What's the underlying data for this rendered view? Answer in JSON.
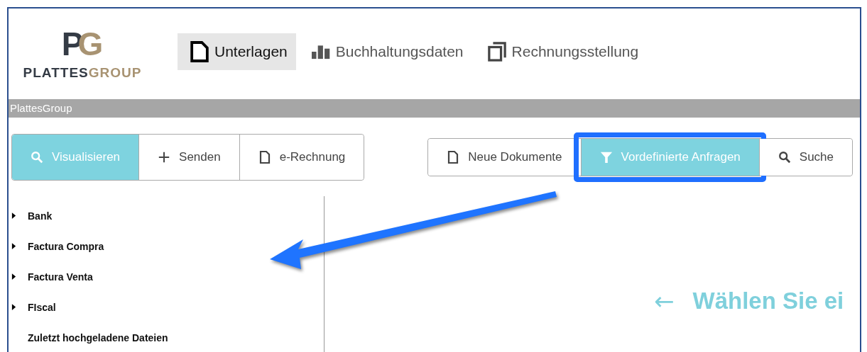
{
  "logo": {
    "mark": [
      "P",
      "G"
    ],
    "word": [
      "PLATTES",
      "GROUP"
    ]
  },
  "nav": [
    {
      "label": "Unterlagen",
      "selected": true
    },
    {
      "label": "Buchhaltungsdaten",
      "selected": false
    },
    {
      "label": "Rechnungsstellung",
      "selected": false
    }
  ],
  "breadcrumb": "PlattesGroup",
  "mode_buttons": [
    {
      "label": "Visualisieren",
      "selected": true
    },
    {
      "label": "Senden",
      "selected": false
    },
    {
      "label": "e-Rechnung",
      "selected": false
    }
  ],
  "view_buttons": [
    {
      "label": "Neue Dokumente",
      "selected": false
    },
    {
      "label": "Vordefinierte Anfragen",
      "selected": true
    },
    {
      "label": "Suche",
      "selected": false
    }
  ],
  "tree": [
    {
      "label": "Bank",
      "kind": "folder",
      "expanded": false
    },
    {
      "label": "Factura Compra",
      "kind": "folder",
      "expanded": false
    },
    {
      "label": "Factura Venta",
      "kind": "folder",
      "expanded": false
    },
    {
      "label": "FIscal",
      "kind": "folder",
      "expanded": false
    },
    {
      "label": "Zuletzt hochgeladene Dateien",
      "kind": "leaf"
    }
  ],
  "hint": {
    "arrow": "←",
    "text": "Wählen Sie ei"
  }
}
